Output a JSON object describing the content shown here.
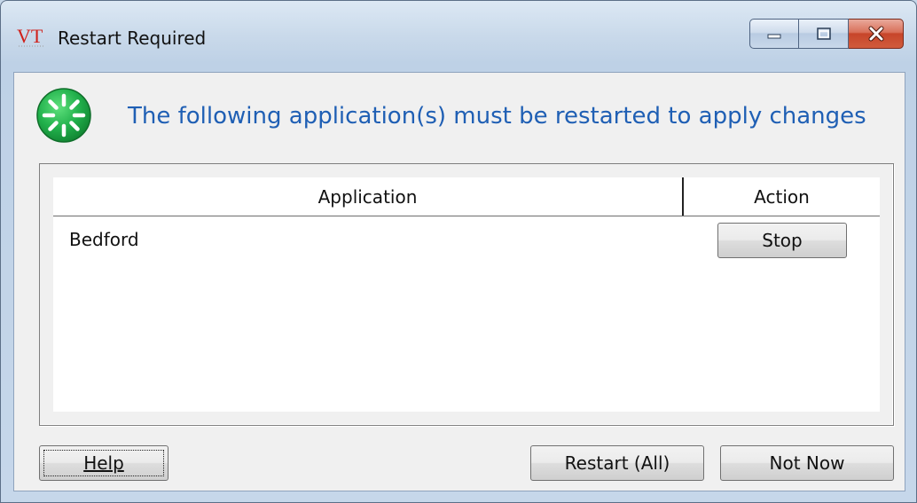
{
  "window": {
    "title": "Restart Required",
    "logo_text": "VT",
    "caption_buttons": [
      "minimize",
      "maximize",
      "close"
    ]
  },
  "header": {
    "message": "The following application(s) must be restarted to apply changes",
    "icon": "restart-spinner-icon",
    "icon_color": "#22b14c"
  },
  "table": {
    "columns": [
      "Application",
      "Action"
    ],
    "rows": [
      {
        "application": "Bedford",
        "action_label": "Stop"
      }
    ]
  },
  "buttons": {
    "help": "Help",
    "restart_all": "Restart (All)",
    "not_now": "Not Now"
  },
  "colors": {
    "header_text": "#1f5fb4",
    "logo_red": "#d0201a"
  }
}
